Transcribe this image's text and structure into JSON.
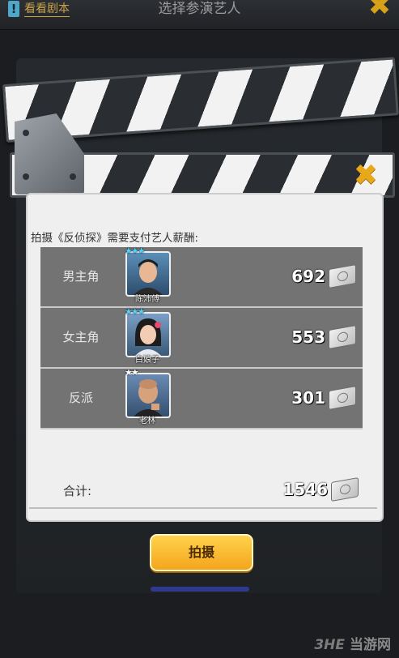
{
  "header": {
    "script_label": "看看剧本",
    "title": "选择参演艺人",
    "close_icon": "close-x-icon"
  },
  "panel": {
    "prompt": "拍摄《反侦探》需要支付艺人薪酬:",
    "rows": [
      {
        "role": "男主角",
        "actor": "陈沛傅",
        "stars": 3,
        "star_color": "#4fd0ff",
        "pay": "692"
      },
      {
        "role": "女主角",
        "actor": "白娘子",
        "stars": 3,
        "star_color": "#4fd0ff",
        "pay": "553"
      },
      {
        "role": "反派",
        "actor": "老林",
        "stars": 2,
        "star_color": "#ffffff",
        "pay": "301"
      }
    ],
    "total_label": "合计:",
    "total_value": "1546"
  },
  "actions": {
    "shoot_label": "拍摄"
  },
  "watermark": {
    "logo": "3HE",
    "text": "当游网"
  },
  "colors": {
    "accent": "#f4a51c",
    "table_bg": "#737373",
    "card_bg": "#efefef"
  }
}
